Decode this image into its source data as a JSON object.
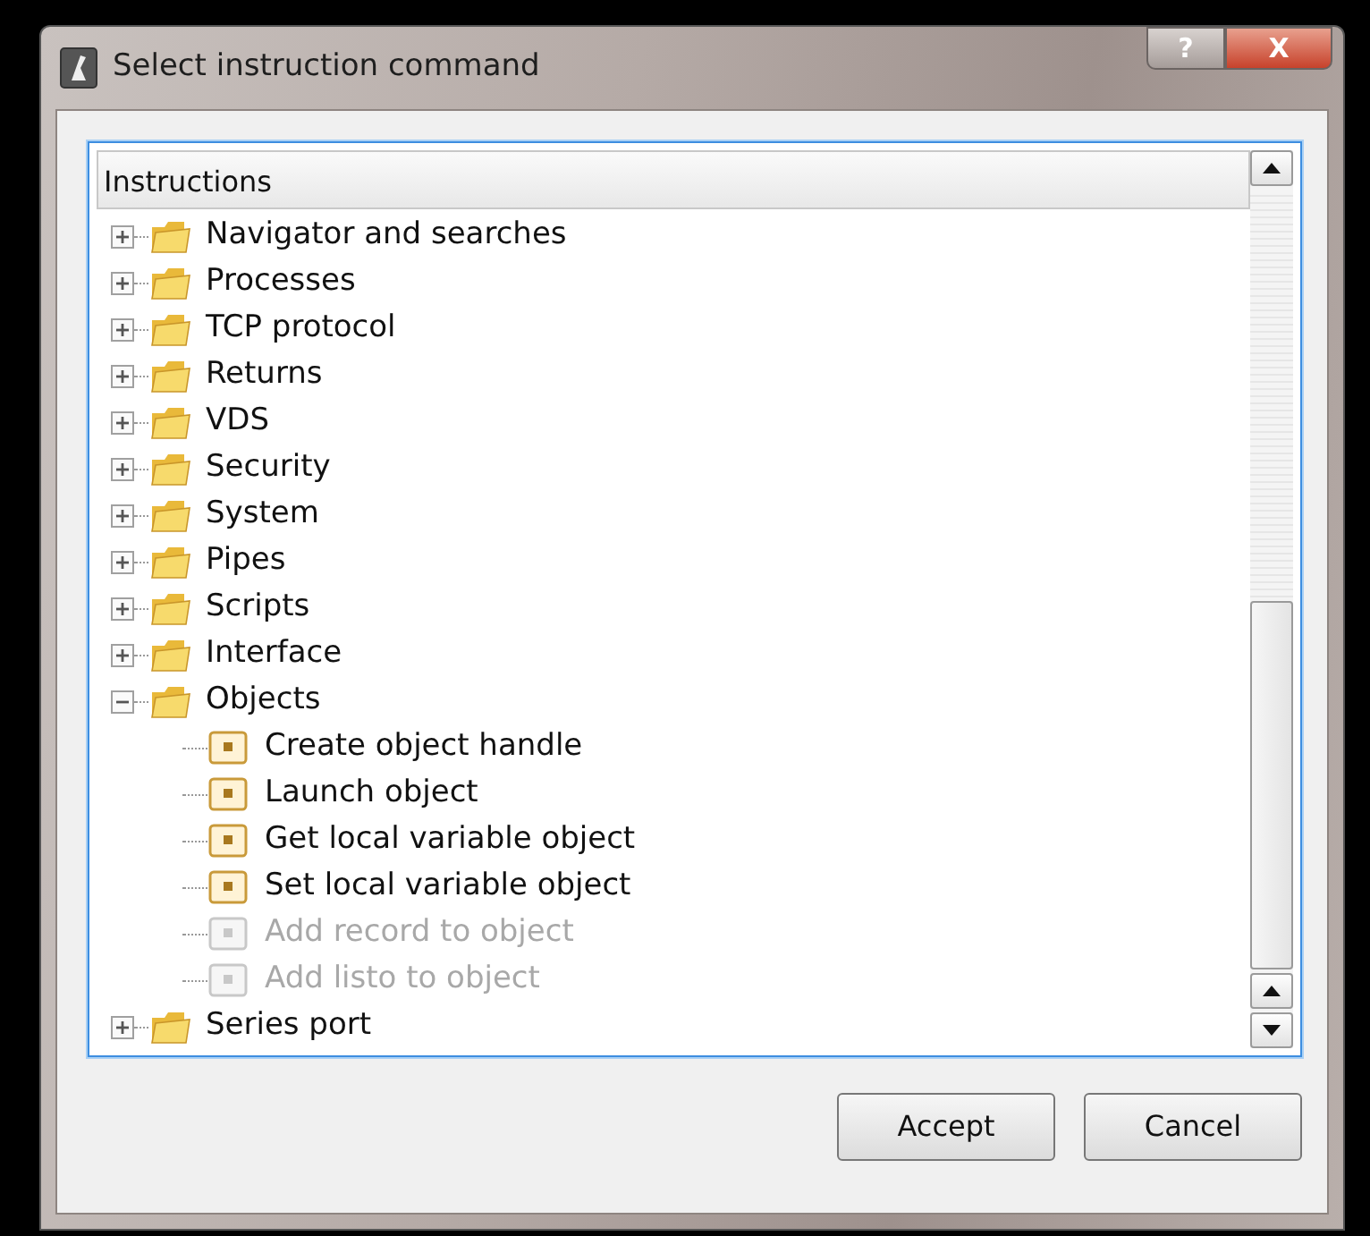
{
  "window": {
    "title": "Select instruction command",
    "help_button": "?",
    "close_button": "X"
  },
  "tree": {
    "header": "Instructions",
    "items": [
      {
        "label": "Navigator and searches",
        "expanded": false
      },
      {
        "label": "Processes",
        "expanded": false
      },
      {
        "label": "TCP protocol",
        "expanded": false
      },
      {
        "label": "Returns",
        "expanded": false
      },
      {
        "label": "VDS",
        "expanded": false
      },
      {
        "label": "Security",
        "expanded": false
      },
      {
        "label": "System",
        "expanded": false
      },
      {
        "label": "Pipes",
        "expanded": false
      },
      {
        "label": "Scripts",
        "expanded": false
      },
      {
        "label": "Interface",
        "expanded": false
      },
      {
        "label": "Objects",
        "expanded": true,
        "children": [
          {
            "label": "Create object handle",
            "disabled": false
          },
          {
            "label": "Launch object",
            "disabled": false
          },
          {
            "label": "Get local variable object",
            "disabled": false
          },
          {
            "label": "Set local variable object",
            "disabled": false
          },
          {
            "label": "Add record to object",
            "disabled": true
          },
          {
            "label": "Add listo to object",
            "disabled": true
          }
        ]
      },
      {
        "label": "Series port",
        "expanded": false
      }
    ]
  },
  "buttons": [
    {
      "label": "Accept"
    },
    {
      "label": "Cancel"
    }
  ]
}
